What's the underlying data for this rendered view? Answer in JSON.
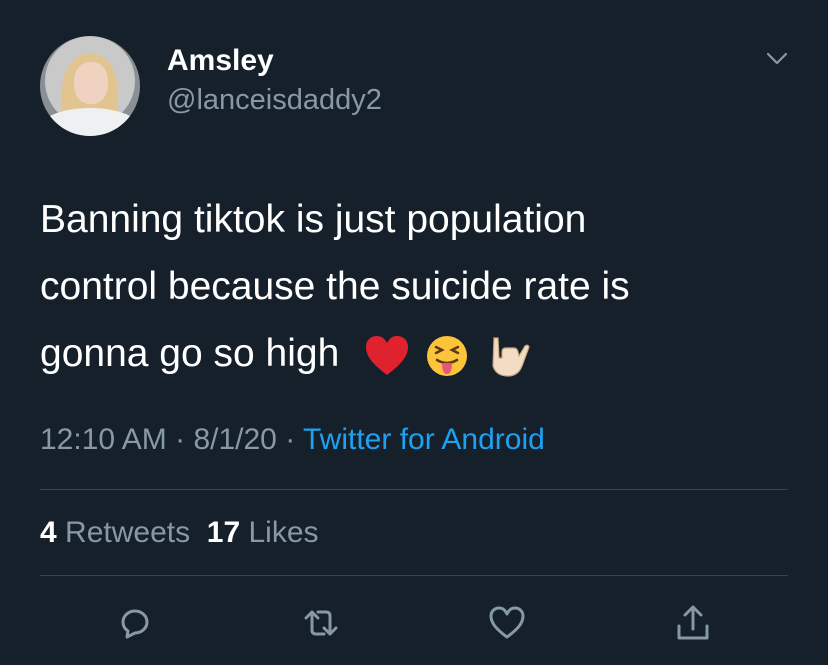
{
  "tweet": {
    "author_name": "Amsley",
    "author_handle": "@lanceisdaddy2",
    "text_lines": [
      "Banning tiktok is just population",
      "control because the suicide rate is",
      "gonna go so high"
    ],
    "emojis": [
      "red-heart",
      "squinting-face-with-tongue",
      "love-you-gesture"
    ],
    "time": "12:10 AM",
    "date": "8/1/20",
    "separator": "·",
    "source": "Twitter for Android",
    "retweet_count": "4",
    "retweet_label": "Retweets",
    "like_count": "17",
    "like_label": "Likes"
  },
  "icons": {
    "menu": "chevron-down-icon",
    "reply": "reply-icon",
    "retweet": "retweet-icon",
    "like": "heart-icon",
    "share": "share-icon"
  },
  "colors": {
    "background": "#15202b",
    "text": "#ffffff",
    "secondary": "#8899a6",
    "link": "#1da1f2",
    "divider": "#38444d"
  }
}
